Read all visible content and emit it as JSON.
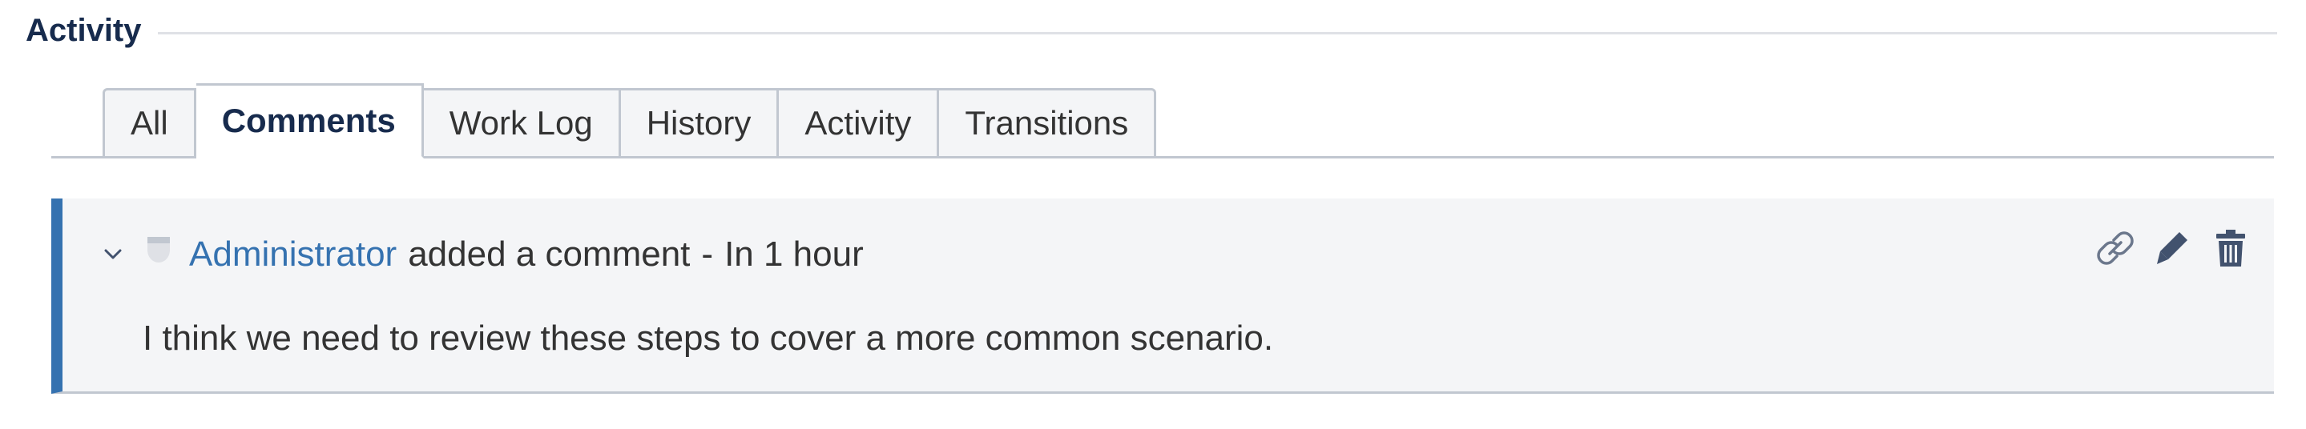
{
  "section": {
    "title": "Activity"
  },
  "tabs": [
    {
      "label": "All",
      "active": false
    },
    {
      "label": "Comments",
      "active": true
    },
    {
      "label": "Work Log",
      "active": false
    },
    {
      "label": "History",
      "active": false
    },
    {
      "label": "Activity",
      "active": false
    },
    {
      "label": "Transitions",
      "active": false
    }
  ],
  "comment": {
    "author": "Administrator",
    "action": "added a comment",
    "separator": "-",
    "time": "In 1 hour",
    "body": "I think we need to review these steps to cover a more common scenario.",
    "icons": {
      "collapse": "chevron-down-icon",
      "avatar": "user-avatar",
      "link": "link-icon",
      "edit": "pencil-icon",
      "delete": "trash-icon"
    }
  },
  "colors": {
    "accent": "#3572b0",
    "panel_bg": "#f4f5f7",
    "border": "#c1c7d0"
  }
}
